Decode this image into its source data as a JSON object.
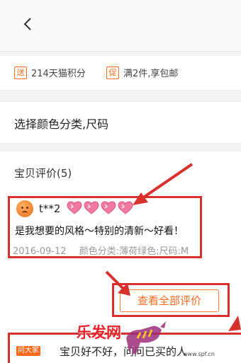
{
  "header": {
    "back_icon": "chevron-left-icon"
  },
  "promotions": [
    {
      "tag": "送",
      "text": "214天猫积分"
    },
    {
      "tag": "促",
      "text": "满2件,享包邮"
    }
  ],
  "sku": {
    "label": "选择颜色分类,尺码"
  },
  "reviews": {
    "title": "宝贝评价(5)",
    "items": [
      {
        "user": "t**2",
        "level_icon": "heart-icon",
        "level_hearts": 4,
        "text": "是我想要的风格～特别的清新～好看！",
        "date": "2016-09-12",
        "sku": "颜色分类:薄荷绿色;尺码:M"
      }
    ],
    "view_all_label": "查看全部评价"
  },
  "ask": {
    "tag": "问大家",
    "text": "宝贝好不好，问问已买的人"
  },
  "annotation_color": "#d8302c",
  "accent_color": "#ff6a1b",
  "watermark": {
    "text": "乐发网",
    "url": "www.spf.cn"
  }
}
